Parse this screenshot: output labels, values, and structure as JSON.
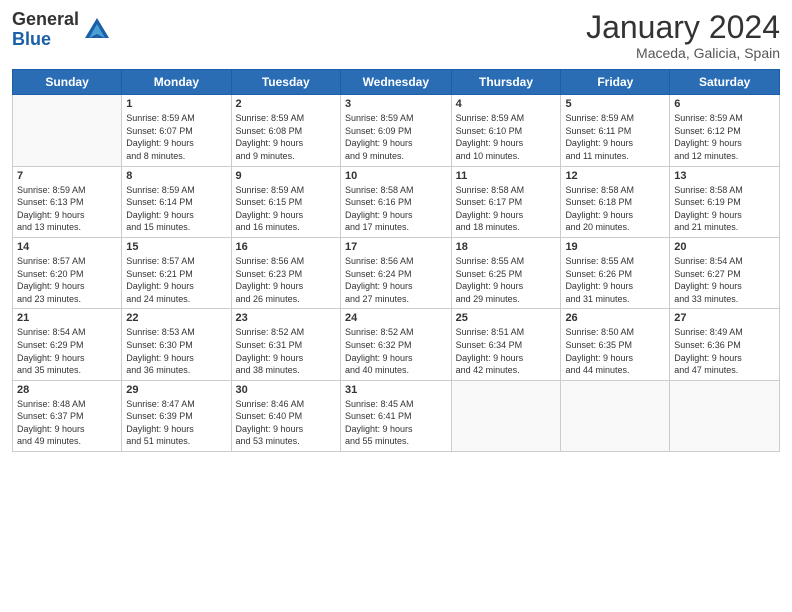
{
  "header": {
    "logo": {
      "general": "General",
      "blue": "Blue"
    },
    "title": "January 2024",
    "subtitle": "Maceda, Galicia, Spain"
  },
  "weekdays": [
    "Sunday",
    "Monday",
    "Tuesday",
    "Wednesday",
    "Thursday",
    "Friday",
    "Saturday"
  ],
  "weeks": [
    [
      {
        "day": "",
        "sunrise": "",
        "sunset": "",
        "daylight": ""
      },
      {
        "day": "1",
        "sunrise": "Sunrise: 8:59 AM",
        "sunset": "Sunset: 6:07 PM",
        "daylight": "Daylight: 9 hours and 8 minutes."
      },
      {
        "day": "2",
        "sunrise": "Sunrise: 8:59 AM",
        "sunset": "Sunset: 6:08 PM",
        "daylight": "Daylight: 9 hours and 9 minutes."
      },
      {
        "day": "3",
        "sunrise": "Sunrise: 8:59 AM",
        "sunset": "Sunset: 6:09 PM",
        "daylight": "Daylight: 9 hours and 9 minutes."
      },
      {
        "day": "4",
        "sunrise": "Sunrise: 8:59 AM",
        "sunset": "Sunset: 6:10 PM",
        "daylight": "Daylight: 9 hours and 10 minutes."
      },
      {
        "day": "5",
        "sunrise": "Sunrise: 8:59 AM",
        "sunset": "Sunset: 6:11 PM",
        "daylight": "Daylight: 9 hours and 11 minutes."
      },
      {
        "day": "6",
        "sunrise": "Sunrise: 8:59 AM",
        "sunset": "Sunset: 6:12 PM",
        "daylight": "Daylight: 9 hours and 12 minutes."
      }
    ],
    [
      {
        "day": "7",
        "sunrise": "Sunrise: 8:59 AM",
        "sunset": "Sunset: 6:13 PM",
        "daylight": "Daylight: 9 hours and 13 minutes."
      },
      {
        "day": "8",
        "sunrise": "Sunrise: 8:59 AM",
        "sunset": "Sunset: 6:14 PM",
        "daylight": "Daylight: 9 hours and 15 minutes."
      },
      {
        "day": "9",
        "sunrise": "Sunrise: 8:59 AM",
        "sunset": "Sunset: 6:15 PM",
        "daylight": "Daylight: 9 hours and 16 minutes."
      },
      {
        "day": "10",
        "sunrise": "Sunrise: 8:58 AM",
        "sunset": "Sunset: 6:16 PM",
        "daylight": "Daylight: 9 hours and 17 minutes."
      },
      {
        "day": "11",
        "sunrise": "Sunrise: 8:58 AM",
        "sunset": "Sunset: 6:17 PM",
        "daylight": "Daylight: 9 hours and 18 minutes."
      },
      {
        "day": "12",
        "sunrise": "Sunrise: 8:58 AM",
        "sunset": "Sunset: 6:18 PM",
        "daylight": "Daylight: 9 hours and 20 minutes."
      },
      {
        "day": "13",
        "sunrise": "Sunrise: 8:58 AM",
        "sunset": "Sunset: 6:19 PM",
        "daylight": "Daylight: 9 hours and 21 minutes."
      }
    ],
    [
      {
        "day": "14",
        "sunrise": "Sunrise: 8:57 AM",
        "sunset": "Sunset: 6:20 PM",
        "daylight": "Daylight: 9 hours and 23 minutes."
      },
      {
        "day": "15",
        "sunrise": "Sunrise: 8:57 AM",
        "sunset": "Sunset: 6:21 PM",
        "daylight": "Daylight: 9 hours and 24 minutes."
      },
      {
        "day": "16",
        "sunrise": "Sunrise: 8:56 AM",
        "sunset": "Sunset: 6:23 PM",
        "daylight": "Daylight: 9 hours and 26 minutes."
      },
      {
        "day": "17",
        "sunrise": "Sunrise: 8:56 AM",
        "sunset": "Sunset: 6:24 PM",
        "daylight": "Daylight: 9 hours and 27 minutes."
      },
      {
        "day": "18",
        "sunrise": "Sunrise: 8:55 AM",
        "sunset": "Sunset: 6:25 PM",
        "daylight": "Daylight: 9 hours and 29 minutes."
      },
      {
        "day": "19",
        "sunrise": "Sunrise: 8:55 AM",
        "sunset": "Sunset: 6:26 PM",
        "daylight": "Daylight: 9 hours and 31 minutes."
      },
      {
        "day": "20",
        "sunrise": "Sunrise: 8:54 AM",
        "sunset": "Sunset: 6:27 PM",
        "daylight": "Daylight: 9 hours and 33 minutes."
      }
    ],
    [
      {
        "day": "21",
        "sunrise": "Sunrise: 8:54 AM",
        "sunset": "Sunset: 6:29 PM",
        "daylight": "Daylight: 9 hours and 35 minutes."
      },
      {
        "day": "22",
        "sunrise": "Sunrise: 8:53 AM",
        "sunset": "Sunset: 6:30 PM",
        "daylight": "Daylight: 9 hours and 36 minutes."
      },
      {
        "day": "23",
        "sunrise": "Sunrise: 8:52 AM",
        "sunset": "Sunset: 6:31 PM",
        "daylight": "Daylight: 9 hours and 38 minutes."
      },
      {
        "day": "24",
        "sunrise": "Sunrise: 8:52 AM",
        "sunset": "Sunset: 6:32 PM",
        "daylight": "Daylight: 9 hours and 40 minutes."
      },
      {
        "day": "25",
        "sunrise": "Sunrise: 8:51 AM",
        "sunset": "Sunset: 6:34 PM",
        "daylight": "Daylight: 9 hours and 42 minutes."
      },
      {
        "day": "26",
        "sunrise": "Sunrise: 8:50 AM",
        "sunset": "Sunset: 6:35 PM",
        "daylight": "Daylight: 9 hours and 44 minutes."
      },
      {
        "day": "27",
        "sunrise": "Sunrise: 8:49 AM",
        "sunset": "Sunset: 6:36 PM",
        "daylight": "Daylight: 9 hours and 47 minutes."
      }
    ],
    [
      {
        "day": "28",
        "sunrise": "Sunrise: 8:48 AM",
        "sunset": "Sunset: 6:37 PM",
        "daylight": "Daylight: 9 hours and 49 minutes."
      },
      {
        "day": "29",
        "sunrise": "Sunrise: 8:47 AM",
        "sunset": "Sunset: 6:39 PM",
        "daylight": "Daylight: 9 hours and 51 minutes."
      },
      {
        "day": "30",
        "sunrise": "Sunrise: 8:46 AM",
        "sunset": "Sunset: 6:40 PM",
        "daylight": "Daylight: 9 hours and 53 minutes."
      },
      {
        "day": "31",
        "sunrise": "Sunrise: 8:45 AM",
        "sunset": "Sunset: 6:41 PM",
        "daylight": "Daylight: 9 hours and 55 minutes."
      },
      {
        "day": "",
        "sunrise": "",
        "sunset": "",
        "daylight": ""
      },
      {
        "day": "",
        "sunrise": "",
        "sunset": "",
        "daylight": ""
      },
      {
        "day": "",
        "sunrise": "",
        "sunset": "",
        "daylight": ""
      }
    ]
  ]
}
